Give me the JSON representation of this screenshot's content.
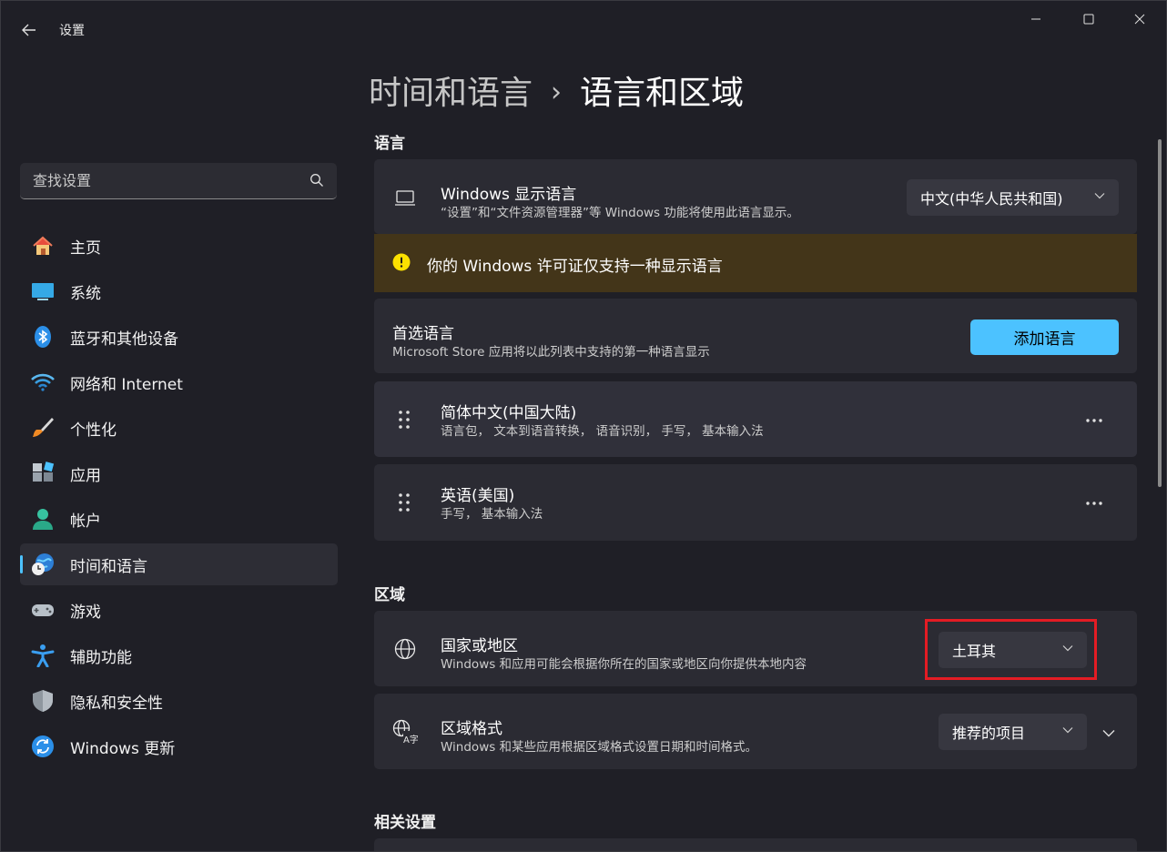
{
  "window": {
    "title": "设置",
    "controls": {
      "minimize": "minimize",
      "maximize": "maximize",
      "close": "close"
    }
  },
  "sidebar": {
    "search_placeholder": "查找设置",
    "items": [
      {
        "label": "主页",
        "icon": "home-icon"
      },
      {
        "label": "系统",
        "icon": "system-icon"
      },
      {
        "label": "蓝牙和其他设备",
        "icon": "bluetooth-icon"
      },
      {
        "label": "网络和 Internet",
        "icon": "wifi-icon"
      },
      {
        "label": "个性化",
        "icon": "brush-icon"
      },
      {
        "label": "应用",
        "icon": "apps-icon"
      },
      {
        "label": "帐户",
        "icon": "account-icon"
      },
      {
        "label": "时间和语言",
        "icon": "time-language-icon",
        "active": true
      },
      {
        "label": "游戏",
        "icon": "gamepad-icon"
      },
      {
        "label": "辅助功能",
        "icon": "accessibility-icon"
      },
      {
        "label": "隐私和安全性",
        "icon": "shield-icon"
      },
      {
        "label": "Windows 更新",
        "icon": "update-icon"
      }
    ]
  },
  "breadcrumb": {
    "parent": "时间和语言",
    "separator": "›",
    "current": "语言和区域"
  },
  "language_section": {
    "title": "语言",
    "display_language": {
      "title": "Windows 显示语言",
      "description": "“设置”和“文件资源管理器”等 Windows 功能将使用此语言显示。",
      "value": "中文(中华人民共和国)"
    },
    "warning": "你的 Windows 许可证仅支持一种显示语言",
    "preferred": {
      "title": "首选语言",
      "description": "Microsoft Store 应用将以此列表中支持的第一种语言显示",
      "add_button": "添加语言"
    },
    "languages": [
      {
        "name": "简体中文(中国大陆)",
        "features": "语言包， 文本到语音转换， 语音识别， 手写， 基本输入法"
      },
      {
        "name": "英语(美国)",
        "features": "手写， 基本输入法"
      }
    ]
  },
  "region_section": {
    "title": "区域",
    "country": {
      "title": "国家或地区",
      "description": "Windows 和应用可能会根据你所在的国家或地区向你提供本地内容",
      "value": "土耳其"
    },
    "format": {
      "title": "区域格式",
      "description": "Windows 和某些应用根据区域格式设置日期和时间格式。",
      "value": "推荐的项目"
    }
  },
  "related_section": {
    "title": "相关设置"
  },
  "colors": {
    "accent": "#4cc2ff",
    "warning_bg": "#433519",
    "warning_icon": "#fce100",
    "highlight": "#e41c24"
  }
}
